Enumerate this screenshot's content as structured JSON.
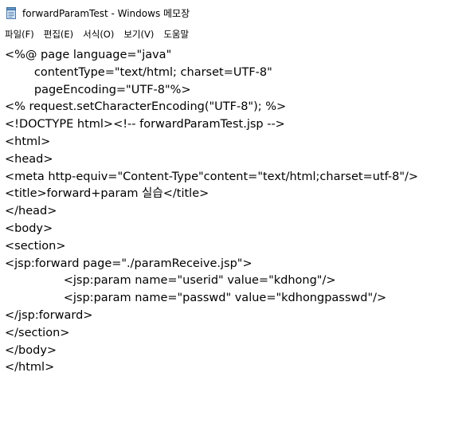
{
  "window": {
    "title": "forwardParamTest - Windows 메모장"
  },
  "menu": [
    {
      "label": "파일(F)"
    },
    {
      "label": "편집(E)"
    },
    {
      "label": "서식(O)"
    },
    {
      "label": "보기(V)"
    },
    {
      "label": "도움말"
    }
  ],
  "editor": {
    "content": "<%@ page language=\"java\"\n        contentType=\"text/html; charset=UTF-8\"\n        pageEncoding=\"UTF-8\"%>\n<% request.setCharacterEncoding(\"UTF-8\"); %>\n<!DOCTYPE html><!-- forwardParamTest.jsp -->\n<html>\n<head>\n<meta http-equiv=\"Content-Type\"content=\"text/html;charset=utf-8\"/>\n<title>forward+param 실습</title>\n</head>\n<body>\n<section>\n<jsp:forward page=\"./paramReceive.jsp\">\n\t\t<jsp:param name=\"userid\" value=\"kdhong\"/>\n\t\t<jsp:param name=\"passwd\" value=\"kdhongpasswd\"/>\n</jsp:forward>\n</section>\n</body>\n</html>"
  },
  "icons": {
    "app": "notepad-icon"
  }
}
